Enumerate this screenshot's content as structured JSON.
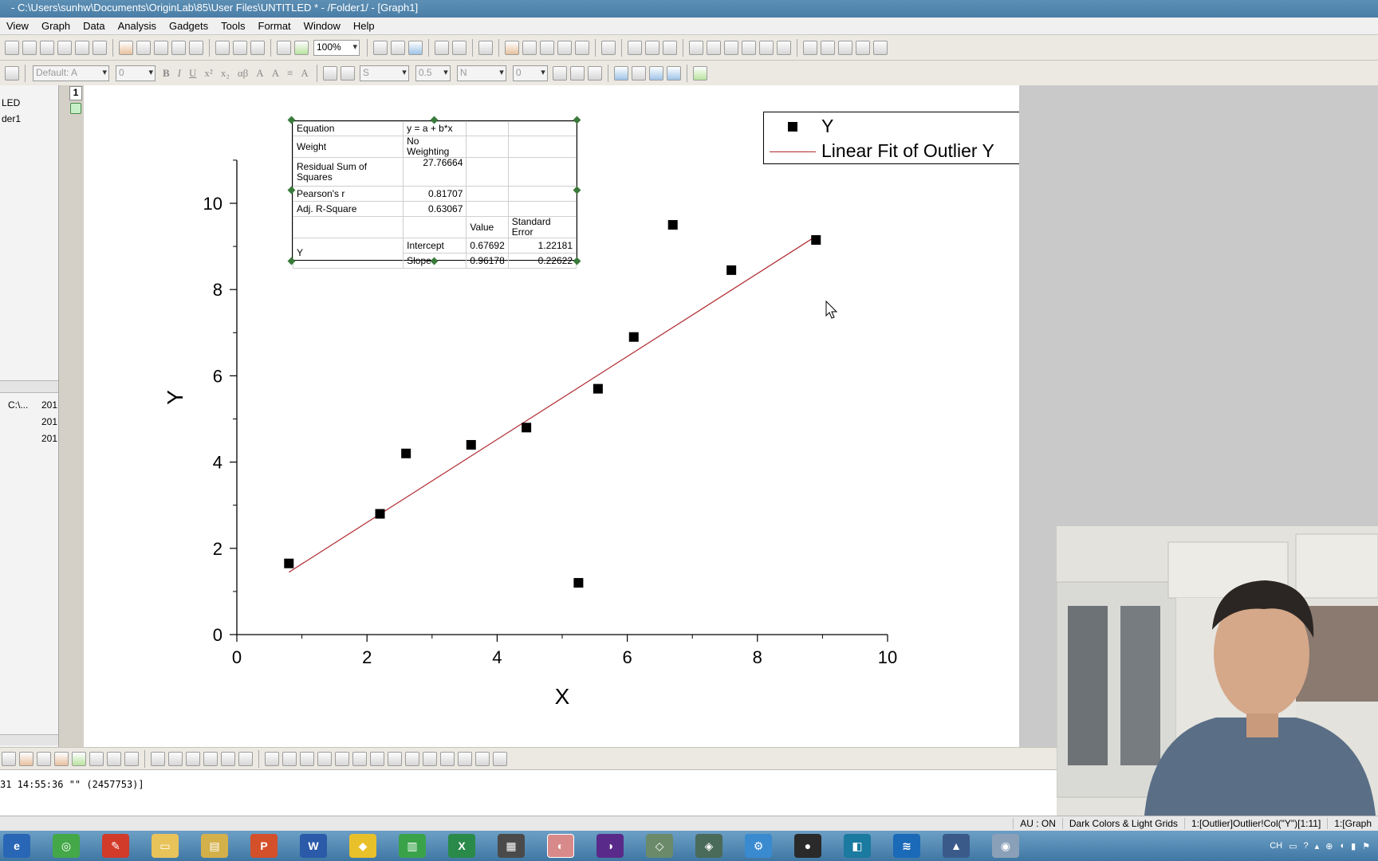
{
  "window": {
    "title": "- C:\\Users\\sunhw\\Documents\\OriginLab\\85\\User Files\\UNTITLED * - /Folder1/ - [Graph1]"
  },
  "menu": [
    "View",
    "Graph",
    "Data",
    "Analysis",
    "Gadgets",
    "Tools",
    "Format",
    "Window",
    "Help"
  ],
  "toolbar1": {
    "zoom": "100%"
  },
  "toolbar2": {
    "font": "Default: A",
    "font_size": "0",
    "line_style": "S",
    "line_width": "0.5",
    "fill_label": "N",
    "fill_size": "0"
  },
  "left_panel": {
    "top_items": [
      "LED",
      "der1"
    ],
    "file_rows": [
      {
        "path": "C:\\...",
        "date": "201"
      },
      {
        "path": "",
        "date": "201"
      },
      {
        "path": "",
        "date": "201"
      }
    ]
  },
  "page_tab": "1",
  "fit_table": {
    "equation_label": "Equation",
    "equation": "y = a + b*x",
    "weight_label": "Weight",
    "weight": "No Weighting",
    "rss_label": "Residual Sum of Squares",
    "rss": "27.76664",
    "pearson_label": "Pearson's r",
    "pearson": "0.81707",
    "adjr_label": "Adj. R-Square",
    "adjr": "0.63067",
    "value_header": "Value",
    "stderr_header": "Standard Error",
    "param_group": "Y",
    "intercept_label": "Intercept",
    "intercept_value": "0.67692",
    "intercept_error": "1.22181",
    "slope_label": "Slope",
    "slope_value": "0.96178",
    "slope_error": "0.22622"
  },
  "legend": {
    "scatter_label": "Y",
    "fit_label": "Linear Fit of Outlier Y"
  },
  "chart_data": {
    "type": "scatter",
    "xlabel": "X",
    "ylabel": "Y",
    "xlim": [
      0,
      10
    ],
    "ylim": [
      0,
      11
    ],
    "xticks": [
      0,
      2,
      4,
      6,
      8,
      10
    ],
    "yticks": [
      0,
      2,
      4,
      6,
      8,
      10
    ],
    "grid": false,
    "legend_position": "top-right",
    "series": [
      {
        "name": "Y",
        "marker": "square",
        "color": "#000000",
        "x": [
          0.8,
          2.2,
          2.6,
          3.6,
          4.45,
          5.25,
          5.55,
          6.1,
          6.7,
          7.6,
          8.9
        ],
        "y": [
          1.65,
          2.8,
          4.2,
          4.4,
          4.8,
          1.2,
          5.7,
          6.9,
          9.5,
          8.45,
          9.15
        ]
      },
      {
        "name": "Linear Fit of Outlier Y",
        "type": "line",
        "color": "#b0282e",
        "x": [
          0.8,
          8.9
        ],
        "y": [
          1.447,
          9.237
        ]
      }
    ]
  },
  "command_line": "31 14:55:36 \"\" (2457753)]",
  "status": {
    "au": "AU : ON",
    "theme": "Dark Colors & Light Grids",
    "cell": "1:[Outlier]Outlier!Col(\"Y\")[1:11]",
    "graph": "1:[Graph"
  },
  "tray": {
    "lang": "CH"
  },
  "colors": {
    "fit_line": "#b0282e",
    "handle": "#3a7a3a",
    "taskbar": "#4f86b2"
  }
}
